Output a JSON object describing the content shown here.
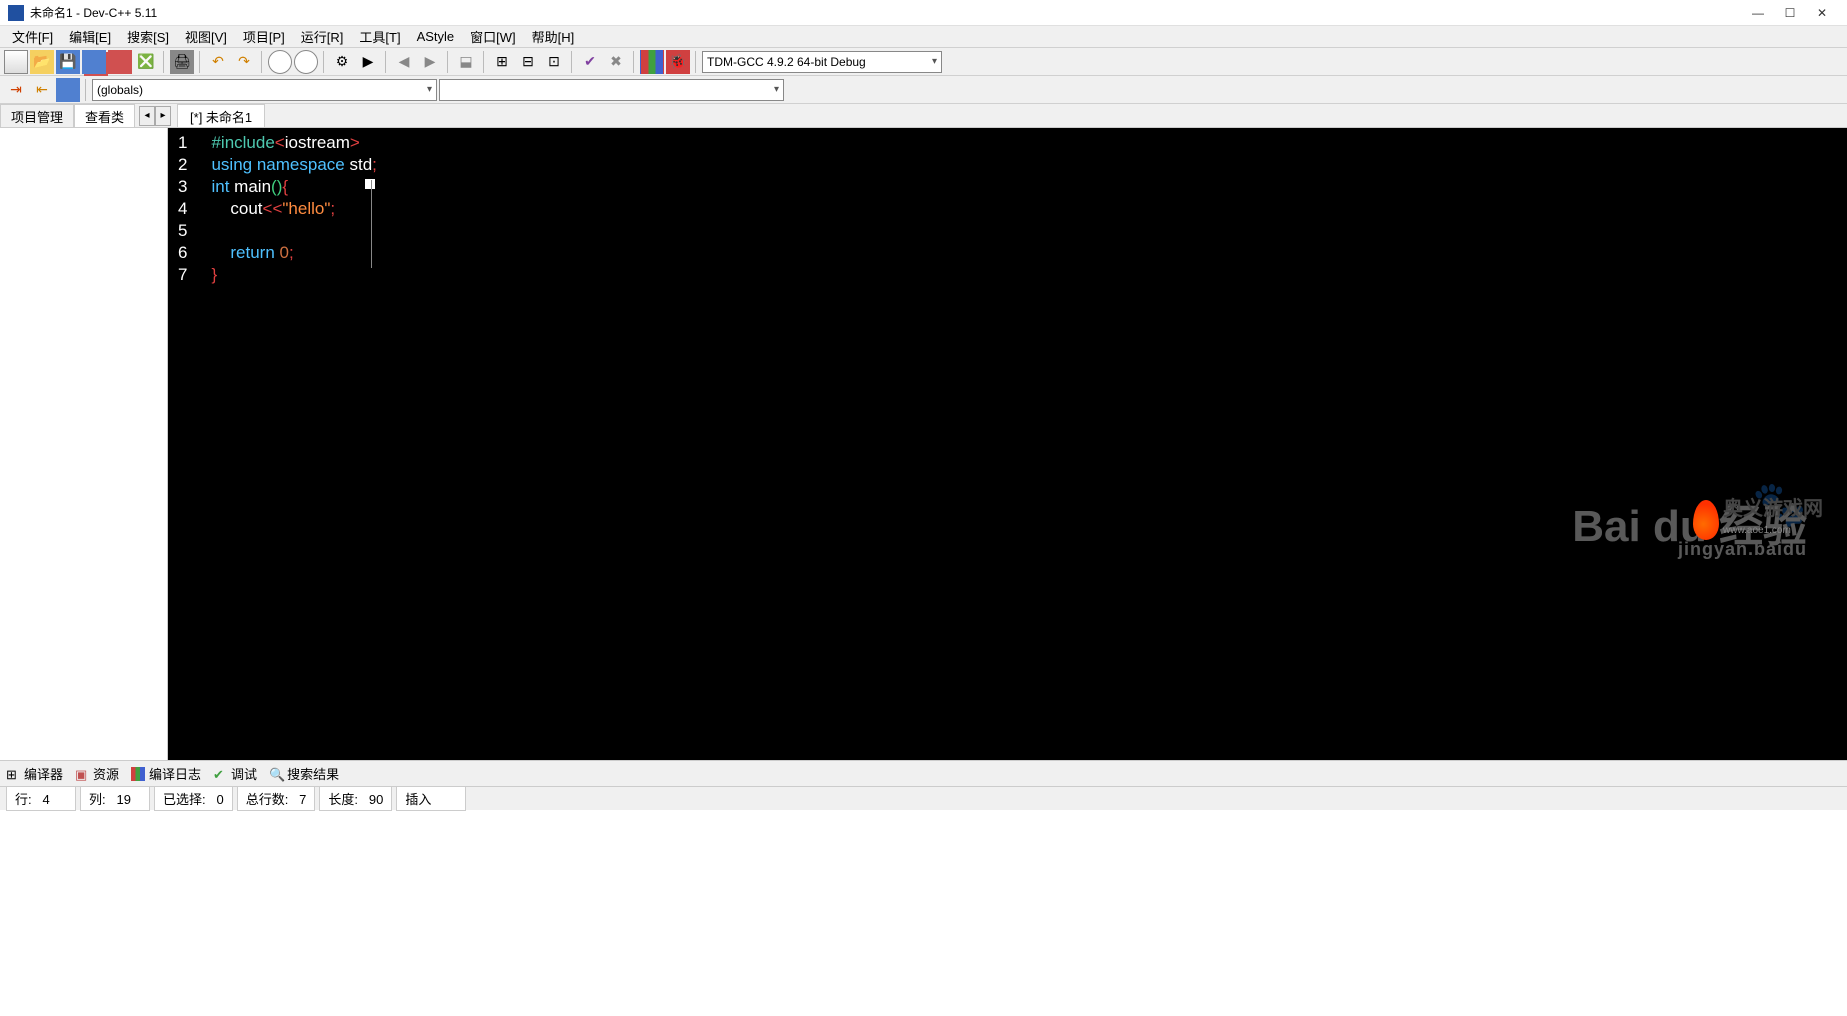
{
  "title": "未命名1 - Dev-C++ 5.11",
  "menu": [
    "文件[F]",
    "编辑[E]",
    "搜索[S]",
    "视图[V]",
    "项目[P]",
    "运行[R]",
    "工具[T]",
    "AStyle",
    "窗口[W]",
    "帮助[H]"
  ],
  "compiler_combo": "TDM-GCC 4.9.2 64-bit Debug",
  "scope_combo": "(globals)",
  "side_tabs": {
    "project": "项目管理",
    "classes": "查看类"
  },
  "file_tab": "[*] 未命名1",
  "code_lines": [
    {
      "n": "1",
      "html": "<span class='c-pre'>#include</span><span class='c-op'>&lt;</span><span class='c-id'>iostream</span><span class='c-op'>&gt;</span>"
    },
    {
      "n": "2",
      "html": "<span class='c-kw'>using</span> <span class='c-kw'>namespace</span> <span class='c-id'>std</span><span class='c-op'>;</span>"
    },
    {
      "n": "3",
      "html": "<span class='c-type'>int</span> <span class='c-id'>main</span><span class='c-paren'>()</span><span class='c-brace'>{</span>"
    },
    {
      "n": "4",
      "html": "    <span class='c-id'>cout</span><span class='c-op'>&lt;&lt;</span><span class='c-str'>\"hello\"</span><span class='c-op'>;</span>"
    },
    {
      "n": "5",
      "html": ""
    },
    {
      "n": "6",
      "html": "    <span class='c-kw'>return</span> <span class='c-num'>0</span><span class='c-op'>;</span>"
    },
    {
      "n": "7",
      "html": "<span class='c-brace'>}</span>"
    }
  ],
  "bottom_tabs": {
    "compiler": "编译器",
    "resources": "资源",
    "log": "编译日志",
    "debug": "调试",
    "results": "搜索结果"
  },
  "status": {
    "line_lbl": "行:",
    "line": "4",
    "col_lbl": "列:",
    "col": "19",
    "sel_lbl": "已选择:",
    "sel": "0",
    "total_lbl": "总行数:",
    "total": "7",
    "len_lbl": "长度:",
    "len": "90",
    "ins": "插入"
  },
  "watermark": {
    "brand": "Bai",
    "brand2": "du",
    "brand3": "经验",
    "url": "jingyan.baidu"
  },
  "corner": {
    "name": "奥义游戏网",
    "url": "www.aoe1.com"
  }
}
